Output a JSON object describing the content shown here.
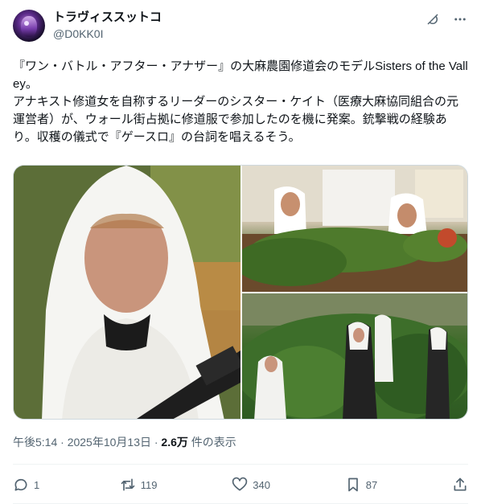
{
  "author": {
    "display_name": "トラヴィススットコ",
    "handle": "@D0KK0I"
  },
  "header_icons": [
    "grok-icon",
    "more-icon"
  ],
  "tweet": {
    "text": "『ワン・バトル・アフター・アナザー』の大麻農園修道会のモデルSisters of the Valley。\nアナキスト修道女を自称するリーダーのシスター・ケイト（医療大麻協同組合の元運営者）が、ウォール街占拠に修道服で参加したのを機に発案。銃撃戦の経験あり。収穫の儀式で『ゲースロ』の台詞を唱えるそう。"
  },
  "meta": {
    "datetime": "午後5:14 · 2025年10月13日 · ",
    "views_count": "2.6万",
    "views_label": " 件の表示"
  },
  "actions": {
    "reply_count": "1",
    "retweet_count": "119",
    "like_count": "340",
    "bookmark_count": "87"
  },
  "colors": {
    "text": "#0f1419",
    "secondary": "#536471",
    "border": "#cfd9de"
  }
}
